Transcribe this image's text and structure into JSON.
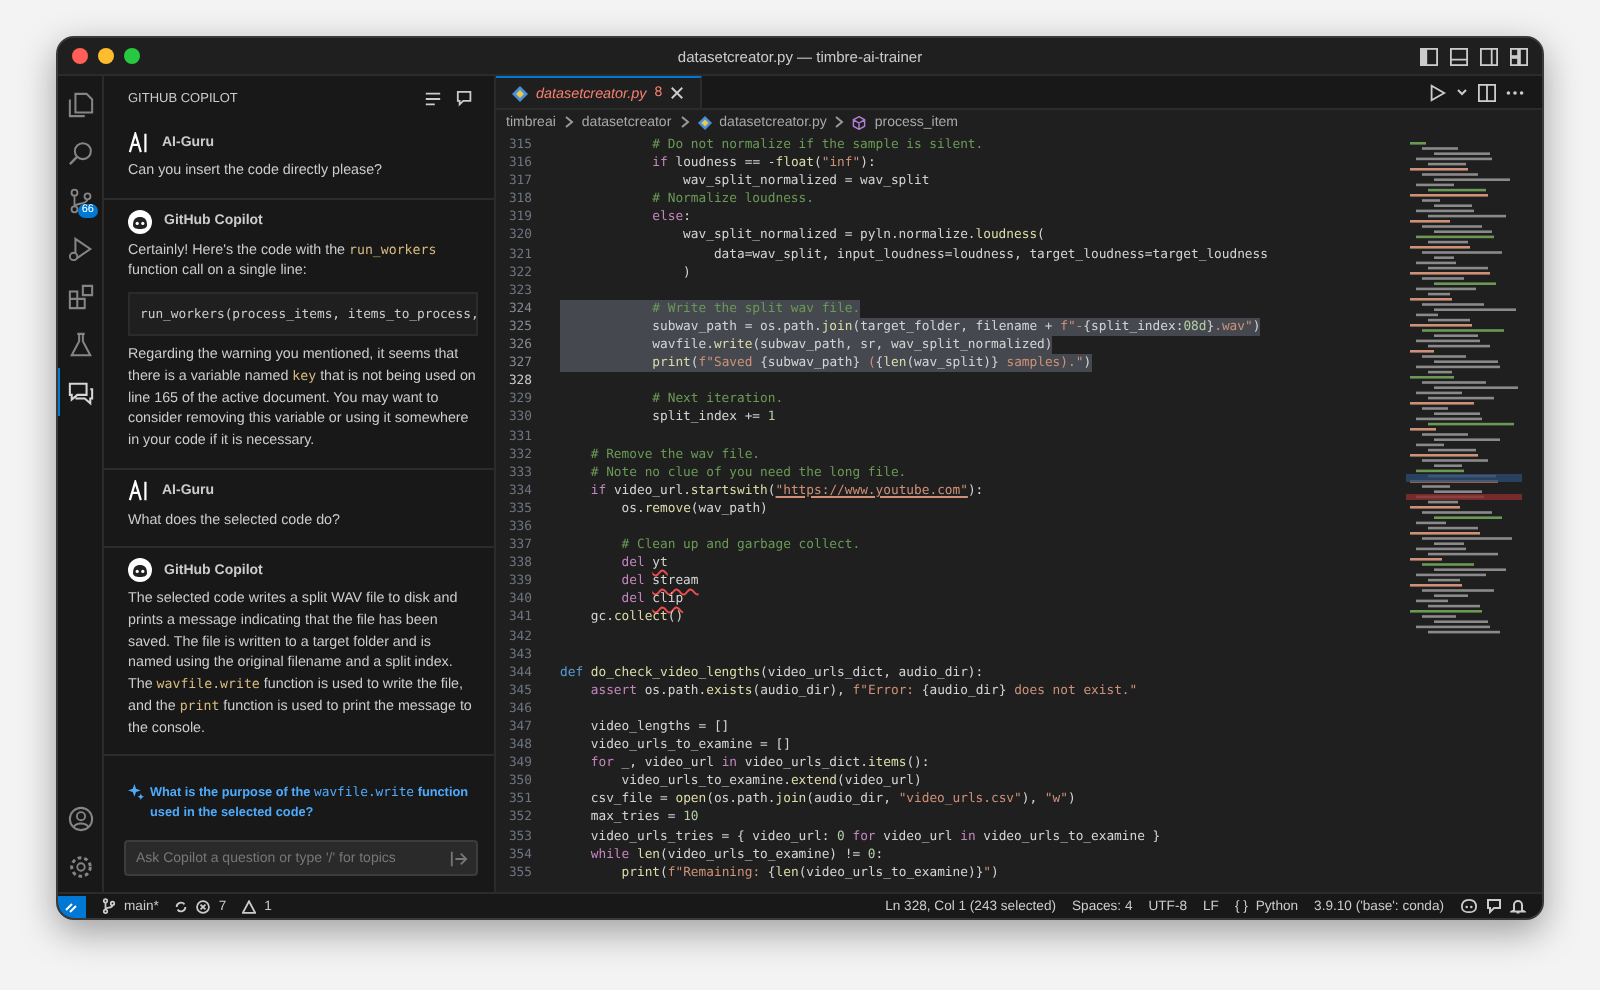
{
  "window": {
    "title": "datasetcreator.py — timbre-ai-trainer"
  },
  "activity_bar": {
    "items": [
      {
        "kind": "files",
        "selected": false
      },
      {
        "kind": "search",
        "selected": false
      },
      {
        "kind": "source-control",
        "selected": false,
        "badge": "66"
      },
      {
        "kind": "run-debug",
        "selected": false
      },
      {
        "kind": "extensions",
        "selected": false
      },
      {
        "kind": "testing",
        "selected": false
      },
      {
        "kind": "chat",
        "selected": true
      }
    ]
  },
  "chat": {
    "header": "GITHUB COPILOT",
    "messages": [
      {
        "kind": "user",
        "author": "AI-Guru",
        "blocks": [
          {
            "kind": "paragraph",
            "segments": [
              {
                "kind": "text",
                "text": "Can you insert the code directly please?"
              }
            ]
          }
        ]
      },
      {
        "kind": "assistant",
        "author": "GitHub Copilot",
        "blocks": [
          {
            "kind": "paragraph",
            "segments": [
              {
                "kind": "text",
                "text": "Certainly! Here's the code with the "
              },
              {
                "kind": "code",
                "text": "run_workers"
              },
              {
                "kind": "text",
                "text": " function call on a single line:"
              }
            ]
          },
          {
            "kind": "code",
            "text": "run_workers(process_items, items_to_process,"
          },
          {
            "kind": "paragraph",
            "segments": [
              {
                "kind": "text",
                "text": "Regarding the warning you mentioned, it seems that there is a variable named "
              },
              {
                "kind": "code",
                "text": "key"
              },
              {
                "kind": "text",
                "text": " that is not being used on line 165 of the active document. You may want to consider removing this variable or using it somewhere in your code if it is necessary."
              }
            ]
          }
        ]
      },
      {
        "kind": "user",
        "author": "AI-Guru",
        "blocks": [
          {
            "kind": "paragraph",
            "segments": [
              {
                "kind": "text",
                "text": "What does the selected code do?"
              }
            ]
          }
        ]
      },
      {
        "kind": "assistant",
        "author": "GitHub Copilot",
        "blocks": [
          {
            "kind": "paragraph",
            "segments": [
              {
                "kind": "text",
                "text": "The selected code writes a split WAV file to disk and prints a message indicating that the file has been saved. The file is written to a target folder and is named using the original filename and a split index. The "
              },
              {
                "kind": "code",
                "text": "wavfile.write"
              },
              {
                "kind": "text",
                "text": " function is used to write the file, and the "
              },
              {
                "kind": "code",
                "text": "print"
              },
              {
                "kind": "text",
                "text": " function is used to print the message to the console."
              }
            ]
          }
        ]
      }
    ],
    "suggestion": {
      "segments": [
        {
          "kind": "text",
          "text": "What is the purpose of the "
        },
        {
          "kind": "code",
          "text": "wavfile.write"
        },
        {
          "kind": "text",
          "text": " function used in the selected code?"
        }
      ]
    },
    "input": {
      "placeholder": "Ask Copilot a question or type '/' for topics"
    }
  },
  "editor": {
    "tabs": [
      {
        "label": "datasetcreator.py",
        "count": "8",
        "selected": true
      }
    ],
    "breadcrumbs": [
      {
        "kind": "folder",
        "text": "timbreai"
      },
      {
        "kind": "folder",
        "text": "datasetcreator"
      },
      {
        "kind": "file",
        "text": "datasetcreator.py"
      },
      {
        "kind": "symbol",
        "text": "process_item"
      }
    ],
    "lines": [
      {
        "number": "315",
        "selected": false,
        "current": false,
        "tokens": [
          {
            "kind": "comment",
            "text": "            # Do not normalize if the sample is silent."
          }
        ]
      },
      {
        "number": "316",
        "selected": false,
        "current": false,
        "tokens": [
          {
            "kind": "keyword",
            "text": "            if"
          },
          {
            "kind": "text",
            "text": " loudness == -"
          },
          {
            "kind": "func",
            "text": "float"
          },
          {
            "kind": "text",
            "text": "("
          },
          {
            "kind": "string",
            "text": "\"inf\""
          },
          {
            "kind": "text",
            "text": "):"
          }
        ]
      },
      {
        "number": "317",
        "selected": false,
        "current": false,
        "tokens": [
          {
            "kind": "text",
            "text": "                wav_split_normalized = wav_split"
          }
        ]
      },
      {
        "number": "318",
        "selected": false,
        "current": false,
        "tokens": [
          {
            "kind": "comment",
            "text": "            # Normalize loudness."
          }
        ]
      },
      {
        "number": "319",
        "selected": false,
        "current": false,
        "tokens": [
          {
            "kind": "keyword",
            "text": "            else"
          },
          {
            "kind": "text",
            "text": ":"
          }
        ]
      },
      {
        "number": "320",
        "selected": false,
        "current": false,
        "tokens": [
          {
            "kind": "text",
            "text": "                wav_split_normalized = pyln.normalize."
          },
          {
            "kind": "func",
            "text": "loudness"
          },
          {
            "kind": "text",
            "text": "("
          }
        ]
      },
      {
        "number": "321",
        "selected": false,
        "current": false,
        "tokens": [
          {
            "kind": "text",
            "text": "                    data=wav_split, input_loudness=loudness, target_loudness=target_loudness"
          }
        ]
      },
      {
        "number": "322",
        "selected": false,
        "current": false,
        "tokens": [
          {
            "kind": "text",
            "text": "                )"
          }
        ]
      },
      {
        "number": "323",
        "selected": false,
        "current": false
      },
      {
        "number": "324",
        "selected": true,
        "current": false,
        "tokens": [
          {
            "kind": "comment",
            "text": "            # Write the split wav file."
          }
        ]
      },
      {
        "number": "325",
        "selected": true,
        "current": false,
        "tokens": [
          {
            "kind": "text",
            "text": "            subwav_path = os.path."
          },
          {
            "kind": "func",
            "text": "join"
          },
          {
            "kind": "text",
            "text": "(target_folder, filename + "
          },
          {
            "kind": "string",
            "text": "f\"-"
          },
          {
            "kind": "text",
            "text": "{split_index:"
          },
          {
            "kind": "number",
            "text": "08d"
          },
          {
            "kind": "text",
            "text": "}"
          },
          {
            "kind": "string",
            "text": ".wav\""
          },
          {
            "kind": "text",
            "text": ")"
          }
        ]
      },
      {
        "number": "326",
        "selected": true,
        "current": false,
        "tokens": [
          {
            "kind": "text",
            "text": "            wavfile."
          },
          {
            "kind": "func",
            "text": "write"
          },
          {
            "kind": "text",
            "text": "(subwav_path, sr, wav_split_normalized)"
          }
        ]
      },
      {
        "number": "327",
        "selected": true,
        "current": false,
        "tokens": [
          {
            "kind": "func",
            "text": "            print"
          },
          {
            "kind": "text",
            "text": "("
          },
          {
            "kind": "string",
            "text": "f\"Saved "
          },
          {
            "kind": "text",
            "text": "{subwav_path}"
          },
          {
            "kind": "string",
            "text": " ("
          },
          {
            "kind": "text",
            "text": "{"
          },
          {
            "kind": "func",
            "text": "len"
          },
          {
            "kind": "text",
            "text": "(wav_split)}"
          },
          {
            "kind": "string",
            "text": " samples).\""
          },
          {
            "kind": "text",
            "text": ")"
          }
        ]
      },
      {
        "number": "328",
        "selected": false,
        "current": true
      },
      {
        "number": "329",
        "selected": false,
        "current": false,
        "tokens": [
          {
            "kind": "comment",
            "text": "            # Next iteration."
          }
        ]
      },
      {
        "number": "330",
        "selected": false,
        "current": false,
        "tokens": [
          {
            "kind": "text",
            "text": "            split_index += "
          },
          {
            "kind": "number",
            "text": "1"
          }
        ]
      },
      {
        "number": "331",
        "selected": false,
        "current": false
      },
      {
        "number": "332",
        "selected": false,
        "current": false,
        "tokens": [
          {
            "kind": "comment",
            "text": "    # Remove the wav file."
          }
        ]
      },
      {
        "number": "333",
        "selected": false,
        "current": false,
        "tokens": [
          {
            "kind": "comment",
            "text": "    # Note no clue of you need the long file."
          }
        ]
      },
      {
        "number": "334",
        "selected": false,
        "current": false,
        "tokens": [
          {
            "kind": "keyword",
            "text": "    if"
          },
          {
            "kind": "text",
            "text": " video_url."
          },
          {
            "kind": "func",
            "text": "startswith"
          },
          {
            "kind": "text",
            "text": "("
          },
          {
            "kind": "link",
            "text": "\"https://www.youtube.com\""
          },
          {
            "kind": "text",
            "text": "):"
          }
        ]
      },
      {
        "number": "335",
        "selected": false,
        "current": false,
        "tokens": [
          {
            "kind": "text",
            "text": "        os."
          },
          {
            "kind": "func",
            "text": "remove"
          },
          {
            "kind": "text",
            "text": "(wav_path)"
          }
        ]
      },
      {
        "number": "336",
        "selected": false,
        "current": false
      },
      {
        "number": "337",
        "selected": false,
        "current": false,
        "tokens": [
          {
            "kind": "comment",
            "text": "        # Clean up and garbage collect."
          }
        ]
      },
      {
        "number": "338",
        "selected": false,
        "current": false,
        "tokens": [
          {
            "kind": "keyword",
            "text": "        del "
          },
          {
            "kind": "squiggle",
            "text": "yt"
          }
        ]
      },
      {
        "number": "339",
        "selected": false,
        "current": false,
        "tokens": [
          {
            "kind": "keyword",
            "text": "        del "
          },
          {
            "kind": "squiggle",
            "text": "stream"
          }
        ]
      },
      {
        "number": "340",
        "selected": false,
        "current": false,
        "tokens": [
          {
            "kind": "keyword",
            "text": "        del "
          },
          {
            "kind": "squiggle",
            "text": "clip"
          }
        ]
      },
      {
        "number": "341",
        "selected": false,
        "current": false,
        "tokens": [
          {
            "kind": "text",
            "text": "    gc."
          },
          {
            "kind": "func",
            "text": "collect"
          },
          {
            "kind": "text",
            "text": "()"
          }
        ]
      },
      {
        "number": "342",
        "selected": false,
        "current": false
      },
      {
        "number": "343",
        "selected": false,
        "current": false
      },
      {
        "number": "344",
        "selected": false,
        "current": false,
        "tokens": [
          {
            "kind": "def",
            "text": "def "
          },
          {
            "kind": "func",
            "text": "do_check_video_lengths"
          },
          {
            "kind": "text",
            "text": "(video_urls_dict, audio_dir):"
          }
        ]
      },
      {
        "number": "345",
        "selected": false,
        "current": false,
        "tokens": [
          {
            "kind": "keyword",
            "text": "    assert"
          },
          {
            "kind": "text",
            "text": " os.path."
          },
          {
            "kind": "func",
            "text": "exists"
          },
          {
            "kind": "text",
            "text": "(audio_dir), "
          },
          {
            "kind": "string",
            "text": "f\"Error: "
          },
          {
            "kind": "text",
            "text": "{audio_dir}"
          },
          {
            "kind": "string",
            "text": " does not exist.\""
          }
        ]
      },
      {
        "number": "346",
        "selected": false,
        "current": false
      },
      {
        "number": "347",
        "selected": false,
        "current": false,
        "tokens": [
          {
            "kind": "text",
            "text": "    video_lengths = []"
          }
        ]
      },
      {
        "number": "348",
        "selected": false,
        "current": false,
        "tokens": [
          {
            "kind": "text",
            "text": "    video_urls_to_examine = []"
          }
        ]
      },
      {
        "number": "349",
        "selected": false,
        "current": false,
        "tokens": [
          {
            "kind": "keyword",
            "text": "    for"
          },
          {
            "kind": "text",
            "text": " _, video_url "
          },
          {
            "kind": "keyword",
            "text": "in"
          },
          {
            "kind": "text",
            "text": " video_urls_dict."
          },
          {
            "kind": "func",
            "text": "items"
          },
          {
            "kind": "text",
            "text": "():"
          }
        ]
      },
      {
        "number": "350",
        "selected": false,
        "current": false,
        "tokens": [
          {
            "kind": "text",
            "text": "        video_urls_to_examine."
          },
          {
            "kind": "func",
            "text": "extend"
          },
          {
            "kind": "text",
            "text": "(video_url)"
          }
        ]
      },
      {
        "number": "351",
        "selected": false,
        "current": false,
        "tokens": [
          {
            "kind": "text",
            "text": "    csv_file = "
          },
          {
            "kind": "func",
            "text": "open"
          },
          {
            "kind": "text",
            "text": "(os.path."
          },
          {
            "kind": "func",
            "text": "join"
          },
          {
            "kind": "text",
            "text": "(audio_dir, "
          },
          {
            "kind": "string",
            "text": "\"video_urls.csv\""
          },
          {
            "kind": "text",
            "text": "), "
          },
          {
            "kind": "string",
            "text": "\"w\""
          },
          {
            "kind": "text",
            "text": ")"
          }
        ]
      },
      {
        "number": "352",
        "selected": false,
        "current": false,
        "tokens": [
          {
            "kind": "text",
            "text": "    max_tries = "
          },
          {
            "kind": "number",
            "text": "10"
          }
        ]
      },
      {
        "number": "353",
        "selected": false,
        "current": false,
        "tokens": [
          {
            "kind": "text",
            "text": "    video_urls_tries = { video_url: "
          },
          {
            "kind": "number",
            "text": "0"
          },
          {
            "kind": "keyword",
            "text": " for"
          },
          {
            "kind": "text",
            "text": " video_url "
          },
          {
            "kind": "keyword",
            "text": "in"
          },
          {
            "kind": "text",
            "text": " video_urls_to_examine }"
          }
        ]
      },
      {
        "number": "354",
        "selected": false,
        "current": false,
        "tokens": [
          {
            "kind": "keyword",
            "text": "    while "
          },
          {
            "kind": "func",
            "text": "len"
          },
          {
            "kind": "text",
            "text": "(video_urls_to_examine) != "
          },
          {
            "kind": "number",
            "text": "0"
          },
          {
            "kind": "text",
            "text": ":"
          }
        ]
      },
      {
        "number": "355",
        "selected": false,
        "current": false,
        "tokens": [
          {
            "kind": "func",
            "text": "        print"
          },
          {
            "kind": "text",
            "text": "("
          },
          {
            "kind": "string",
            "text": "f\"Remaining: "
          },
          {
            "kind": "text",
            "text": "{"
          },
          {
            "kind": "func",
            "text": "len"
          },
          {
            "kind": "text",
            "text": "(video_urls_to_examine)}"
          },
          {
            "kind": "string",
            "text": "\""
          },
          {
            "kind": "text",
            "text": ")"
          }
        ]
      }
    ]
  },
  "status_bar": {
    "branch": "main*",
    "errors": "7",
    "warnings": "1",
    "position": "Ln 328, Col 1 (243 selected)",
    "indentation": "Spaces: 4",
    "encoding": "UTF-8",
    "eol": "LF",
    "language_icon": "{ }",
    "language": "Python",
    "interpreter": "3.9.10 ('base': conda)"
  }
}
